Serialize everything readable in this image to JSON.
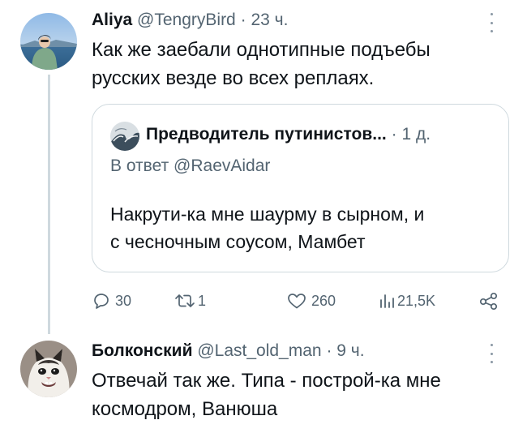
{
  "tweet": {
    "display_name": "Aliya",
    "handle": "@TengryBird",
    "separator": "·",
    "time": "23 ч.",
    "text_line1": "Как же заебали однотипные подъебы",
    "text_line2": "русских везде во всех реплаях.",
    "avatar_icon": "user-avatar-photo",
    "quote": {
      "display_name": "Предводитель путинистов...",
      "separator": "·",
      "time": "1 д.",
      "reply_prefix": "В ответ",
      "reply_handle": "@RaevAidar",
      "text_line1": "Накрути-ка мне шаурму в сырном, и",
      "text_line2": "с чесночным соусом, Мамбет",
      "avatar_icon": "wave-avatar"
    },
    "actions": {
      "replies": "30",
      "reposts": "1",
      "likes": "260",
      "views": "21,5K"
    }
  },
  "reply": {
    "display_name": "Болконский",
    "handle": "@Last_old_man",
    "separator": "·",
    "time": "9 ч.",
    "text_line1": "Отвечай так же. Типа - построй-ка мне",
    "text_line2": "космодром, Ванюша",
    "avatar_icon": "cat-avatar"
  },
  "colors": {
    "text": "#0f1419",
    "secondary": "#536471",
    "border": "#cfd9de"
  }
}
